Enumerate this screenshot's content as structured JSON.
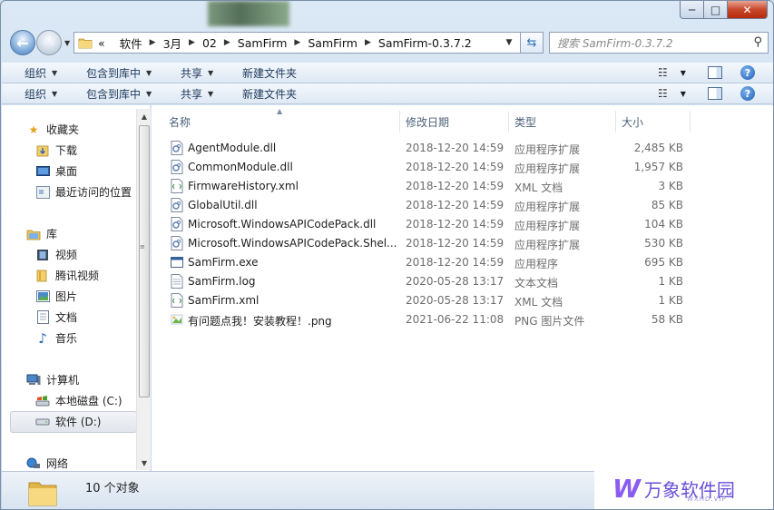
{
  "window": {
    "caption": {
      "min": "─",
      "max": "□",
      "close": "✕"
    }
  },
  "nav": {
    "back_icon": "back-arrow-icon",
    "forward_icon": "forward-arrow-icon",
    "breadcrumb_prefix": "«",
    "breadcrumb": [
      "软件",
      "3月",
      "02",
      "SamFirm",
      "SamFirm",
      "SamFirm-0.3.7.2"
    ],
    "search_placeholder": "搜索 SamFirm-0.3.7.2"
  },
  "toolbar": {
    "organize": "组织",
    "include_in_library": "包含到库中",
    "share": "共享",
    "new_folder": "新建文件夹"
  },
  "sidebar": {
    "favorites": {
      "label": "收藏夹",
      "items": [
        "下载",
        "桌面",
        "最近访问的位置"
      ]
    },
    "libraries": {
      "label": "库",
      "items": [
        "视频",
        "腾讯视频",
        "图片",
        "文档",
        "音乐"
      ]
    },
    "computer": {
      "label": "计算机",
      "items": [
        "本地磁盘 (C:)",
        "软件 (D:)"
      ]
    },
    "network": {
      "label": "网络"
    },
    "selected": "软件 (D:)"
  },
  "columns": [
    "名称",
    "修改日期",
    "类型",
    "大小"
  ],
  "files": [
    {
      "name": "AgentModule.dll",
      "date": "2018-12-20 14:59",
      "type": "应用程序扩展",
      "size": "2,485 KB",
      "icon": "dll"
    },
    {
      "name": "CommonModule.dll",
      "date": "2018-12-20 14:59",
      "type": "应用程序扩展",
      "size": "1,957 KB",
      "icon": "dll"
    },
    {
      "name": "FirmwareHistory.xml",
      "date": "2018-12-20 14:59",
      "type": "XML 文档",
      "size": "3 KB",
      "icon": "xml"
    },
    {
      "name": "GlobalUtil.dll",
      "date": "2018-12-20 14:59",
      "type": "应用程序扩展",
      "size": "85 KB",
      "icon": "dll"
    },
    {
      "name": "Microsoft.WindowsAPICodePack.dll",
      "date": "2018-12-20 14:59",
      "type": "应用程序扩展",
      "size": "104 KB",
      "icon": "dll"
    },
    {
      "name": "Microsoft.WindowsAPICodePack.Shel...",
      "date": "2018-12-20 14:59",
      "type": "应用程序扩展",
      "size": "530 KB",
      "icon": "dll"
    },
    {
      "name": "SamFirm.exe",
      "date": "2018-12-20 14:59",
      "type": "应用程序",
      "size": "695 KB",
      "icon": "exe"
    },
    {
      "name": "SamFirm.log",
      "date": "2020-05-28 13:17",
      "type": "文本文档",
      "size": "1 KB",
      "icon": "txt"
    },
    {
      "name": "SamFirm.xml",
      "date": "2020-05-28 13:17",
      "type": "XML 文档",
      "size": "1 KB",
      "icon": "xml"
    },
    {
      "name": "有问题点我！安装教程！.png",
      "date": "2021-06-22 11:08",
      "type": "PNG 图片文件",
      "size": "58 KB",
      "icon": "png"
    }
  ],
  "status": {
    "count": "10 个对象"
  },
  "watermark": {
    "text": "万象软件园",
    "sub": "WXHD.VIP"
  }
}
